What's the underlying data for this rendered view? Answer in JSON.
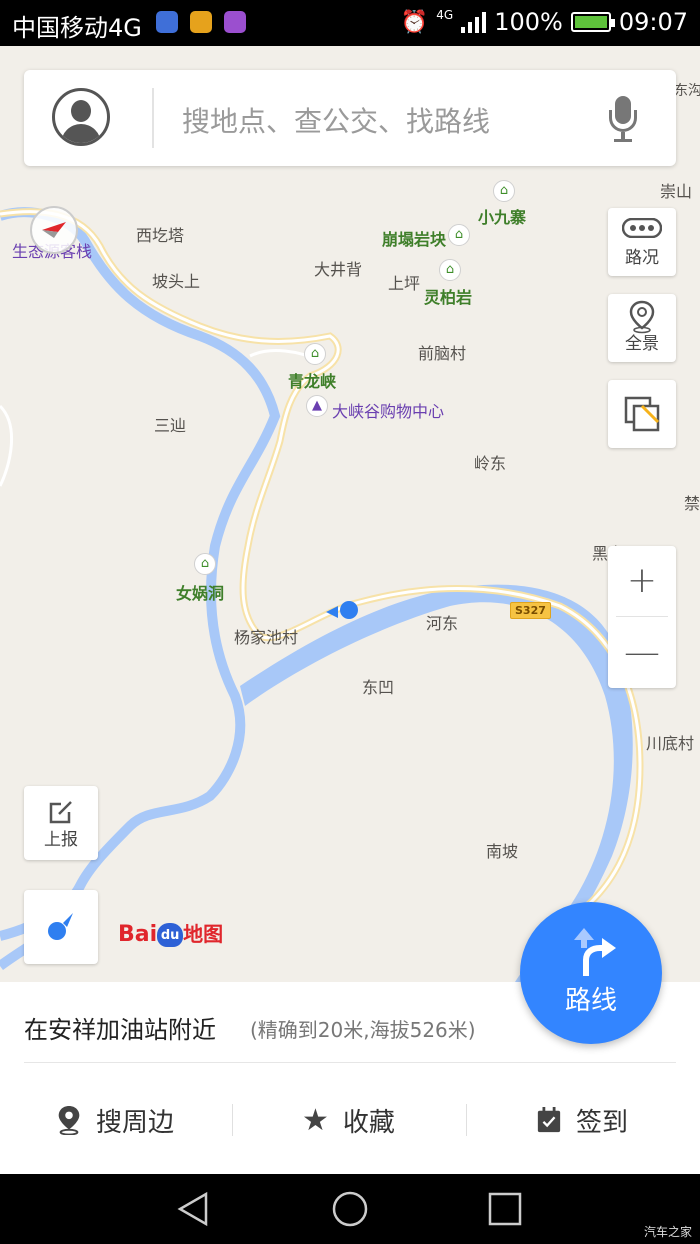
{
  "status_bar": {
    "carrier": "中国移动4G",
    "network": "4G",
    "battery": "100%",
    "time": "09:07"
  },
  "search": {
    "placeholder": "搜地点、查公交、找路线"
  },
  "side_buttons": {
    "traffic": "路况",
    "panorama": "全景"
  },
  "left_buttons": {
    "report": "上报"
  },
  "map_labels": {
    "ecology_inn": "生态源客栈",
    "xiqita": "西圪塔",
    "potoushang": "坡头上",
    "dajingbei": "大井背",
    "xiaojiuzhai": "小九寨",
    "bengtayankuai": "崩塌岩块",
    "shangping": "上坪",
    "lingbaiyan": "灵柏岩",
    "qiannaocun": "前脑村",
    "qinglongxia": "青龙峡",
    "daxiagu": "大峡谷购物中心",
    "sanshan": "三辿",
    "lingdong": "岭东",
    "nvwadong": "女娲洞",
    "yangjiachicun": "杨家池村",
    "hedong": "河东",
    "dongao": "东凹",
    "nanpo": "南坡",
    "chuandicun": "川底村",
    "chongshan": "崇山",
    "dongou": "东沟",
    "heiyao": "黑窑",
    "jin": "禁",
    "road_s327": "S327"
  },
  "logo": {
    "bai": "Bai",
    "du": "du",
    "ditu": "地图"
  },
  "location": {
    "title": "在安祥加油站附近",
    "detail": "(精确到20米,海拔526米)"
  },
  "actions": {
    "nearby": "搜周边",
    "favorite": "收藏",
    "checkin": "签到"
  },
  "route_button": {
    "label": "路线"
  },
  "watermark": "汽车之家",
  "colors": {
    "map_bg": "#f2efe9",
    "river": "#a8c8f8",
    "road": "#f7e2a8",
    "accent_blue": "#3385ff",
    "poi_green": "#3f7f2a",
    "shop_purple": "#6a3fb0"
  }
}
